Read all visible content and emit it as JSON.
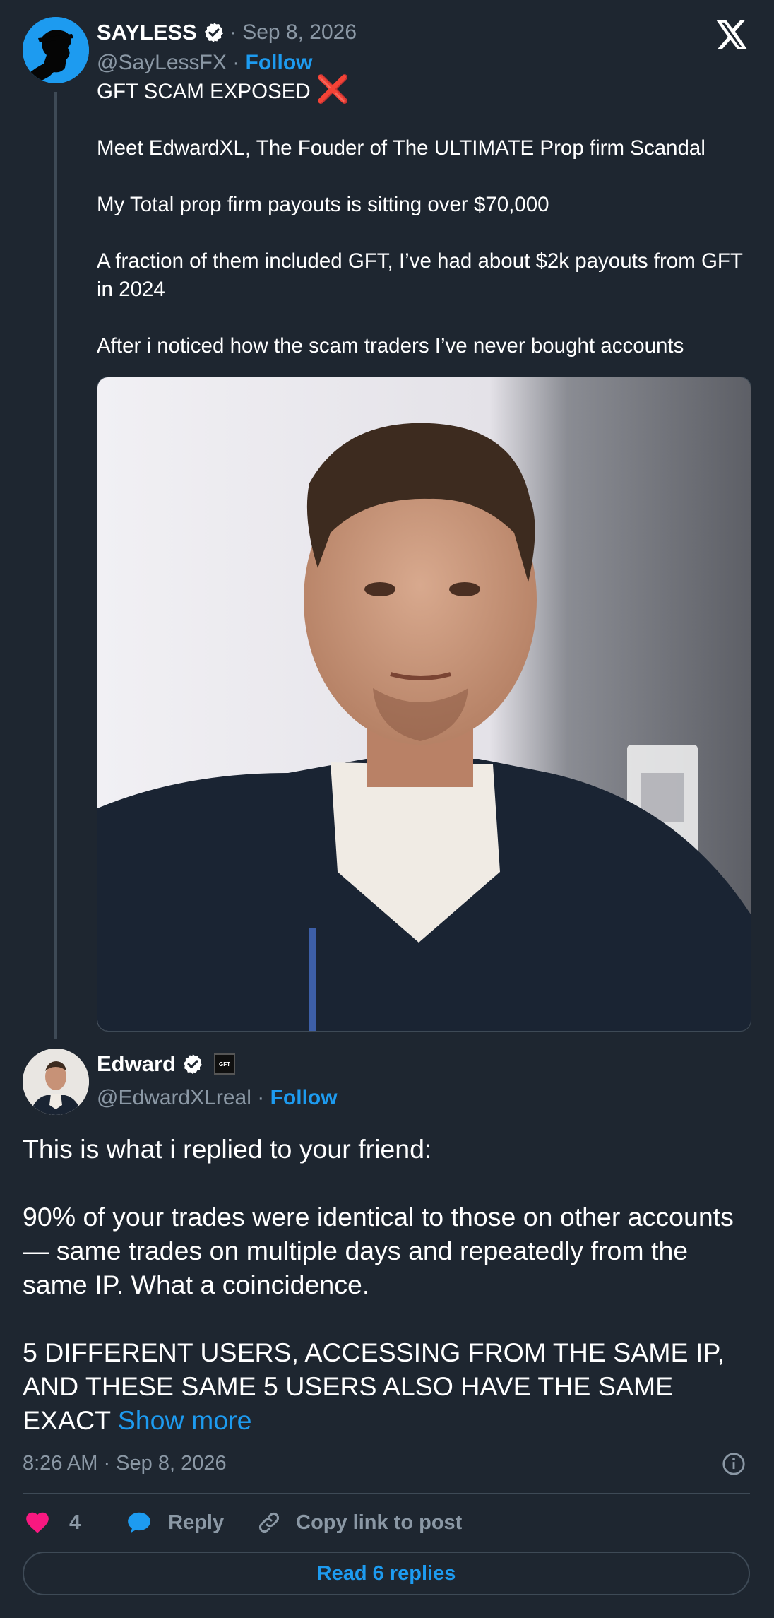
{
  "colors": {
    "background": "#1e2630",
    "accent": "#1d9bf0",
    "like": "#f91880",
    "cross": "#f4212e"
  },
  "quoted": {
    "name": "SAYLESS",
    "date": "· Sep 8, 2026",
    "handle": "@SayLessFX",
    "separator": " · ",
    "follow": "Follow",
    "line1": "GFT SCAM EXPOSED",
    "cross_icon": "❌",
    "line2": "Meet EdwardXL, The Fouder of The ULTIMATE Prop firm Scandal",
    "line3": "My Total prop firm payouts is sitting over $70,000",
    "line4": "A fraction of them included GFT, I’ve had about $2k payouts from GFT in 2024",
    "line5": "After i noticed how the scam traders I’ve never bought accounts"
  },
  "post": {
    "name": "Edward",
    "handle": "@EdwardXLreal",
    "separator": " · ",
    "follow": "Follow",
    "badge_text": "GFT",
    "p1": "This is what i replied to your friend:",
    "p2": "90% of your trades were identical to those on other accounts — same trades on multiple days and repeatedly from the same IP. What a coincidence.",
    "p3": "5 DIFFERENT USERS, ACCESSING FROM THE SAME IP, AND THESE SAME 5 USERS ALSO HAVE THE SAME EXACT",
    "show_more": " Show more",
    "timestamp": "8:26 AM · Sep 8, 2026"
  },
  "actions": {
    "like_count": "4",
    "reply": "Reply",
    "copy_link": "Copy link to post"
  },
  "read_replies": "Read 6 replies"
}
